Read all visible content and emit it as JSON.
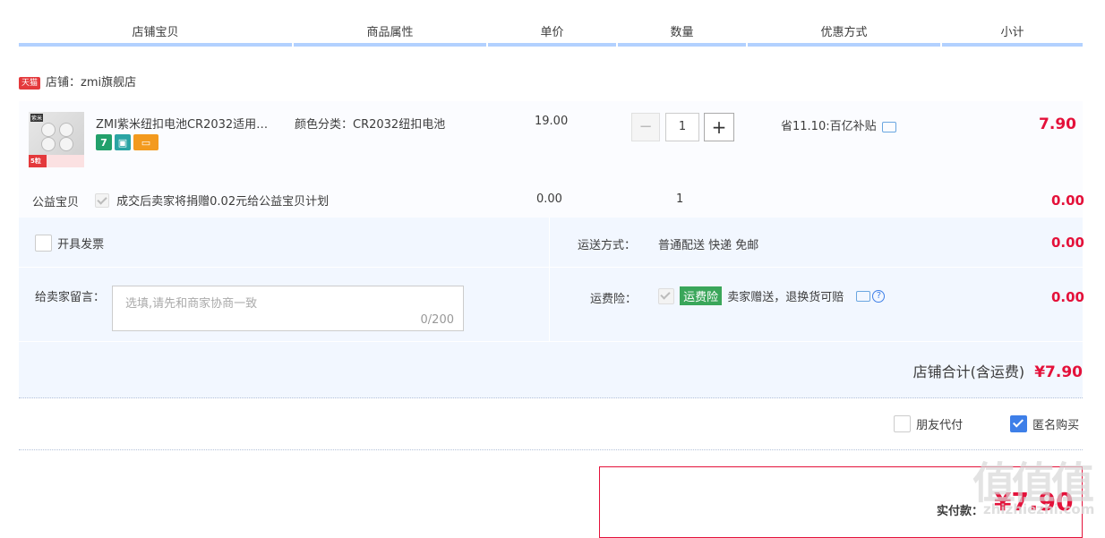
{
  "header": {
    "cols": [
      "店铺宝贝",
      "商品属性",
      "单价",
      "数量",
      "优惠方式",
      "小计"
    ]
  },
  "shop": {
    "badge": "天猫",
    "label": "店铺：zmi旗舰店"
  },
  "item": {
    "title": "ZMI紫米纽扣电池CR2032适用…",
    "property": "颜色分类：CR2032纽扣电池",
    "price": "19.00",
    "qty_minus": "−",
    "qty_value": "1",
    "qty_plus": "+",
    "promo": "省11.10:百亿补贴",
    "subtotal": "7.90",
    "icons": [
      "seven-day-return-icon",
      "quality-badge-icon",
      "credit-card-icon"
    ],
    "thumb_brand": "紫米",
    "thumb_badge": "5粒"
  },
  "charity": {
    "label": "公益宝贝",
    "text": "成交后卖家将捐赠0.02元给公益宝贝计划",
    "price": "0.00",
    "qty": "1",
    "subtotal": "0.00"
  },
  "invoice": {
    "label": "开具发票"
  },
  "shipping": {
    "label": "运送方式：",
    "value": "普通配送 快递 免邮",
    "amount": "0.00"
  },
  "message": {
    "label": "给卖家留言：",
    "placeholder": "选填,请先和商家协商一致",
    "count": "0/200"
  },
  "insurance": {
    "label": "运费险：",
    "badge": "运费险",
    "text": "卖家赠送，退换货可赔",
    "help": "?",
    "amount": "0.00"
  },
  "shop_total": {
    "label": "店铺合计(含运费)",
    "amount": "¥7.90"
  },
  "options": {
    "friend_pay": "朋友代付",
    "anonymous": "匿名购买"
  },
  "payment": {
    "label": "实付款：",
    "amount": "¥7.90"
  },
  "watermark": {
    "glyphs": "值值值",
    "domain": "zhizhiezhi.com"
  },
  "colors": {
    "accent_red": "#e4113a",
    "header_rule": "#b2d1ff",
    "panel_bg": "#f2f7ff",
    "insurance_green": "#3aa65a"
  }
}
